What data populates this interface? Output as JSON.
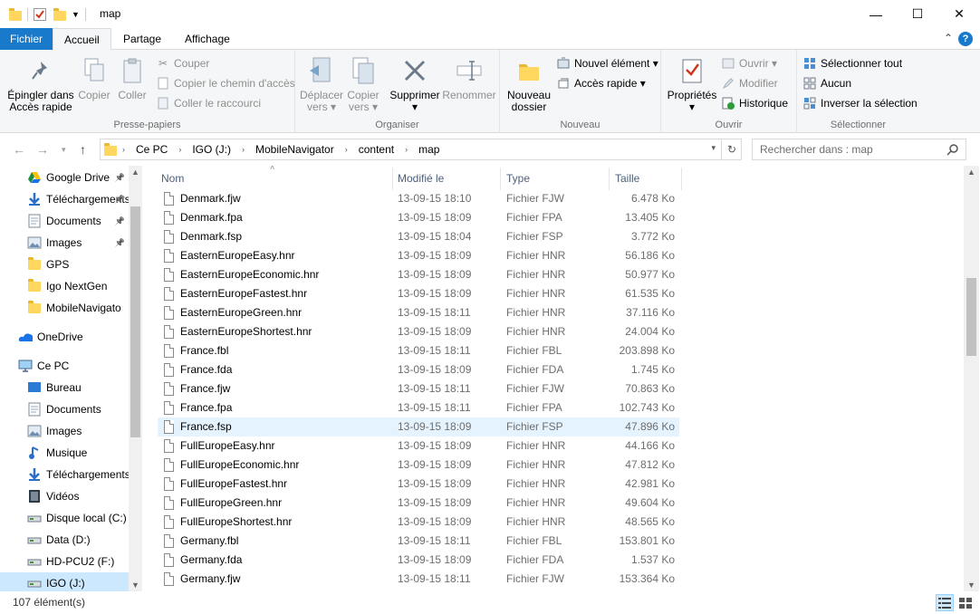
{
  "window": {
    "title": "map",
    "minimize": "—",
    "maximize": "☐",
    "close": "✕"
  },
  "tabs": [
    {
      "label": "Fichier"
    },
    {
      "label": "Accueil"
    },
    {
      "label": "Partage"
    },
    {
      "label": "Affichage"
    }
  ],
  "ribbon": {
    "clipboard": {
      "label": "Presse-papiers",
      "pin": "Épingler dans\nAccès rapide",
      "pin_l1": "Épingler dans",
      "pin_l2": "Accès rapide",
      "copy": "Copier",
      "paste": "Coller",
      "cut": "Couper",
      "copy_path": "Copier le chemin d'accès",
      "paste_shortcut": "Coller le raccourci"
    },
    "organize": {
      "label": "Organiser",
      "move_l1": "Déplacer",
      "move_l2": "vers",
      "copyto_l1": "Copier",
      "copyto_l2": "vers",
      "delete": "Supprimer",
      "rename": "Renommer"
    },
    "new": {
      "label": "Nouveau",
      "new_folder_l1": "Nouveau",
      "new_folder_l2": "dossier",
      "new_item": "Nouvel élément",
      "quick_access": "Accès rapide"
    },
    "open": {
      "label": "Ouvrir",
      "properties": "Propriétés",
      "open": "Ouvrir",
      "edit": "Modifier",
      "history": "Historique"
    },
    "select": {
      "label": "Sélectionner",
      "select_all": "Sélectionner tout",
      "select_none": "Aucun",
      "invert": "Inverser la sélection"
    }
  },
  "address": {
    "crumbs": [
      "Ce PC",
      "IGO (J:)",
      "MobileNavigator",
      "content",
      "map"
    ],
    "search_placeholder": "Rechercher dans : map"
  },
  "navpane": {
    "items": [
      {
        "label": "Google Drive",
        "icon": "google-drive-icon",
        "pinned": true
      },
      {
        "label": "Téléchargements",
        "icon": "download-icon",
        "pinned": true
      },
      {
        "label": "Documents",
        "icon": "documents-icon",
        "pinned": true
      },
      {
        "label": "Images",
        "icon": "images-icon",
        "pinned": true
      },
      {
        "label": "GPS",
        "icon": "folder-icon",
        "pinned": false
      },
      {
        "label": "Igo NextGen",
        "icon": "folder-icon",
        "pinned": false
      },
      {
        "label": "MobileNavigato",
        "icon": "folder-icon",
        "pinned": false
      },
      {
        "label": "OneDrive",
        "icon": "onedrive-icon",
        "pinned": false
      },
      {
        "label": "Ce PC",
        "icon": "computer-icon",
        "pinned": false
      },
      {
        "label": "Bureau",
        "icon": "desktop-icon",
        "pinned": false
      },
      {
        "label": "Documents",
        "icon": "documents-icon",
        "pinned": false
      },
      {
        "label": "Images",
        "icon": "images-icon",
        "pinned": false
      },
      {
        "label": "Musique",
        "icon": "music-icon",
        "pinned": false
      },
      {
        "label": "Téléchargements",
        "icon": "download-icon",
        "pinned": false
      },
      {
        "label": "Vidéos",
        "icon": "videos-icon",
        "pinned": false
      },
      {
        "label": "Disque local (C:)",
        "icon": "drive-icon",
        "pinned": false
      },
      {
        "label": "Data (D:)",
        "icon": "drive-icon",
        "pinned": false
      },
      {
        "label": "HD-PCU2 (F:)",
        "icon": "drive-icon",
        "pinned": false
      },
      {
        "label": "IGO (J:)",
        "icon": "drive-icon",
        "pinned": false
      }
    ]
  },
  "columns": {
    "name": "Nom",
    "date": "Modifié le",
    "type": "Type",
    "size": "Taille"
  },
  "files": [
    {
      "name": "Denmark.fjw",
      "date": "13-09-15 18:10",
      "type": "Fichier FJW",
      "size": "6.478 Ko"
    },
    {
      "name": "Denmark.fpa",
      "date": "13-09-15 18:09",
      "type": "Fichier FPA",
      "size": "13.405 Ko"
    },
    {
      "name": "Denmark.fsp",
      "date": "13-09-15 18:04",
      "type": "Fichier FSP",
      "size": "3.772 Ko"
    },
    {
      "name": "EasternEuropeEasy.hnr",
      "date": "13-09-15 18:09",
      "type": "Fichier HNR",
      "size": "56.186 Ko"
    },
    {
      "name": "EasternEuropeEconomic.hnr",
      "date": "13-09-15 18:09",
      "type": "Fichier HNR",
      "size": "50.977 Ko"
    },
    {
      "name": "EasternEuropeFastest.hnr",
      "date": "13-09-15 18:09",
      "type": "Fichier HNR",
      "size": "61.535 Ko"
    },
    {
      "name": "EasternEuropeGreen.hnr",
      "date": "13-09-15 18:11",
      "type": "Fichier HNR",
      "size": "37.116 Ko"
    },
    {
      "name": "EasternEuropeShortest.hnr",
      "date": "13-09-15 18:09",
      "type": "Fichier HNR",
      "size": "24.004 Ko"
    },
    {
      "name": "France.fbl",
      "date": "13-09-15 18:11",
      "type": "Fichier FBL",
      "size": "203.898 Ko"
    },
    {
      "name": "France.fda",
      "date": "13-09-15 18:09",
      "type": "Fichier FDA",
      "size": "1.745 Ko"
    },
    {
      "name": "France.fjw",
      "date": "13-09-15 18:11",
      "type": "Fichier FJW",
      "size": "70.863 Ko"
    },
    {
      "name": "France.fpa",
      "date": "13-09-15 18:11",
      "type": "Fichier FPA",
      "size": "102.743 Ko"
    },
    {
      "name": "France.fsp",
      "date": "13-09-15 18:09",
      "type": "Fichier FSP",
      "size": "47.896 Ko"
    },
    {
      "name": "FullEuropeEasy.hnr",
      "date": "13-09-15 18:09",
      "type": "Fichier HNR",
      "size": "44.166 Ko"
    },
    {
      "name": "FullEuropeEconomic.hnr",
      "date": "13-09-15 18:09",
      "type": "Fichier HNR",
      "size": "47.812 Ko"
    },
    {
      "name": "FullEuropeFastest.hnr",
      "date": "13-09-15 18:09",
      "type": "Fichier HNR",
      "size": "42.981 Ko"
    },
    {
      "name": "FullEuropeGreen.hnr",
      "date": "13-09-15 18:09",
      "type": "Fichier HNR",
      "size": "49.604 Ko"
    },
    {
      "name": "FullEuropeShortest.hnr",
      "date": "13-09-15 18:09",
      "type": "Fichier HNR",
      "size": "48.565 Ko"
    },
    {
      "name": "Germany.fbl",
      "date": "13-09-15 18:11",
      "type": "Fichier FBL",
      "size": "153.801 Ko"
    },
    {
      "name": "Germany.fda",
      "date": "13-09-15 18:09",
      "type": "Fichier FDA",
      "size": "1.537 Ko"
    },
    {
      "name": "Germany.fjw",
      "date": "13-09-15 18:11",
      "type": "Fichier FJW",
      "size": "153.364 Ko"
    }
  ],
  "highlighted_file": "France.fsp",
  "status": {
    "count": "107 élément(s)"
  },
  "colors": {
    "accent": "#1979ca",
    "selection": "#cce8ff",
    "hover": "#e5f3ff"
  }
}
